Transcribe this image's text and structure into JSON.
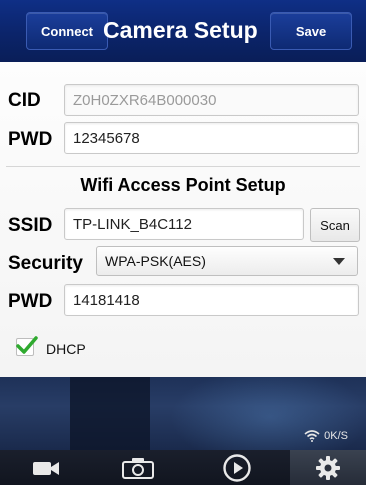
{
  "header": {
    "connect_label": "Connect",
    "title": "Camera Setup",
    "save_label": "Save"
  },
  "camera": {
    "cid_label": "CID",
    "cid_value": "Z0H0ZXR64B000030",
    "pwd_label": "PWD",
    "pwd_value": "12345678"
  },
  "wifi": {
    "section_title": "Wifi Access Point Setup",
    "ssid_label": "SSID",
    "ssid_value": "TP-LINK_B4C112",
    "scan_label": "Scan",
    "security_label": "Security",
    "security_value": "WPA-PSK(AES)",
    "pwd_label": "PWD",
    "pwd_value": "14181418",
    "dhcp_label": "DHCP",
    "dhcp_checked": true
  },
  "status": {
    "speed": "0K/S"
  },
  "tabs": [
    {
      "icon": "video-camera-icon"
    },
    {
      "icon": "camera-icon"
    },
    {
      "icon": "play-icon"
    },
    {
      "icon": "gear-icon",
      "active": true
    }
  ],
  "colors": {
    "header_bg": "#0b246a",
    "check_green": "#2faa2f"
  }
}
